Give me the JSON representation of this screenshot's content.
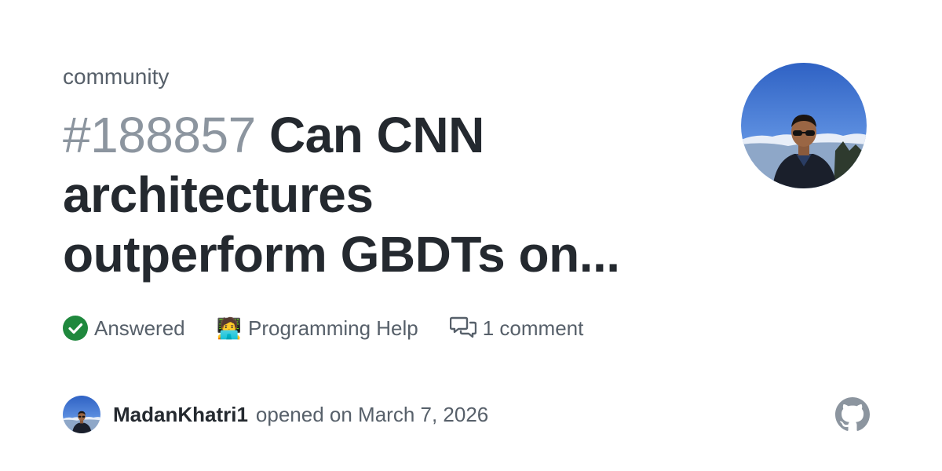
{
  "repo": "community",
  "issue": {
    "number": "#188857",
    "title_line1": " Can CNN",
    "title_line2": "architectures",
    "title_line3": "outperform GBDTs on..."
  },
  "meta": {
    "status_label": "Answered",
    "category_label": "Programming Help",
    "category_emoji": "🧑‍💻",
    "comments_label": "1 comment"
  },
  "author": {
    "username": "MadanKhatri1",
    "opened_text": "opened on March 7, 2026"
  },
  "icons": {
    "status": "check-circle-icon",
    "comments": "comment-discussion-icon",
    "brand": "github-logo-icon"
  },
  "colors": {
    "success": "#1f883d",
    "title": "#24292f",
    "muted": "#57606a",
    "number": "#8c959f"
  }
}
